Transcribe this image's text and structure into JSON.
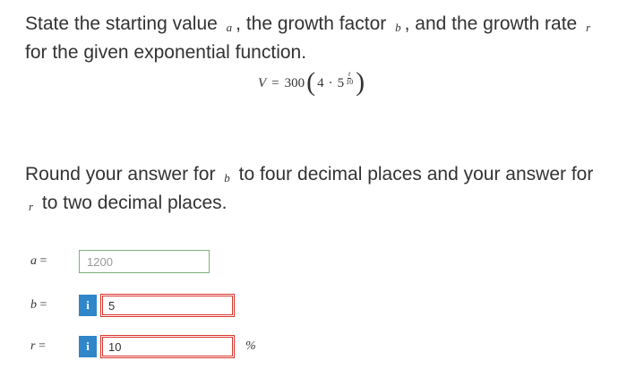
{
  "question": {
    "prompt_part1": "State the starting value",
    "var_a": "a",
    "prompt_part2": ", the growth factor",
    "var_b": "b",
    "prompt_part3": ", and the growth rate",
    "var_r": "r",
    "prompt_part4": "for the given exponential function.",
    "equation": {
      "lhs": "V",
      "eq": "=",
      "coefficient": "300",
      "paren_open": "(",
      "inner_base": "4",
      "dot": "·",
      "power_base": "5",
      "exp_num": "t",
      "exp_den": "10",
      "paren_close": ")"
    }
  },
  "instruction": {
    "part1": "Round your answer for",
    "var_b": "b",
    "part2": "to four decimal places and your answer for",
    "var_r": "r",
    "part3": "to two decimal places."
  },
  "answers": {
    "a": {
      "label": "a",
      "eq": "=",
      "value": "1200",
      "status": "correct"
    },
    "b": {
      "label": "b",
      "eq": "=",
      "info_symbol": "i",
      "value": "5",
      "status": "incorrect"
    },
    "r": {
      "label": "r",
      "eq": "=",
      "info_symbol": "i",
      "value": "10",
      "unit": "%",
      "status": "incorrect"
    }
  },
  "colors": {
    "correct_border": "#7fb27f",
    "incorrect_border": "#d9342b",
    "info_button": "#2f86c9"
  },
  "icons": {
    "info": "info-icon"
  }
}
